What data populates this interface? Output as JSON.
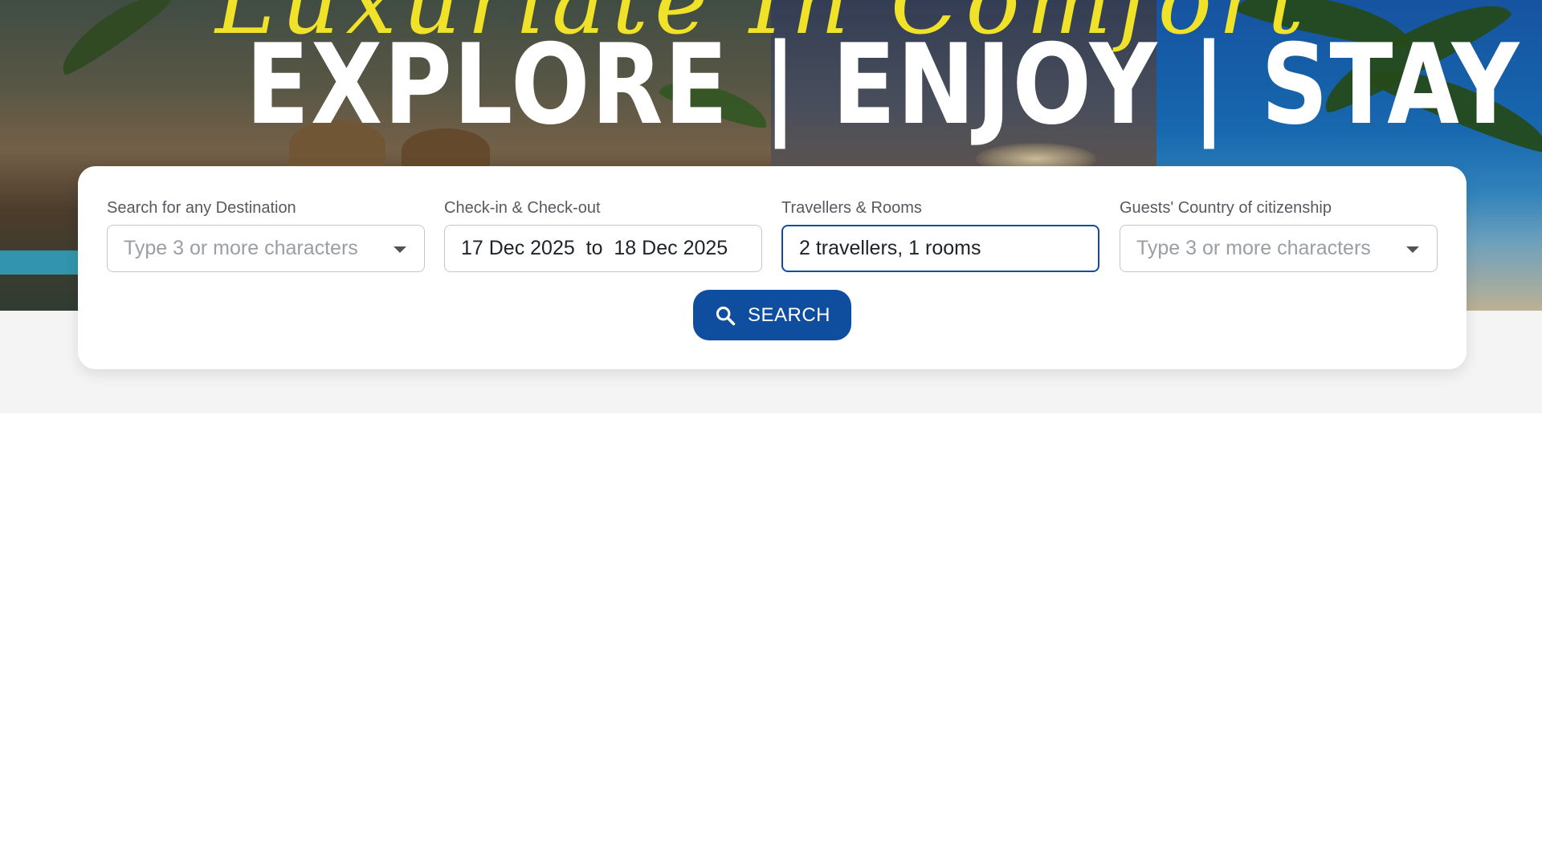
{
  "hero": {
    "script_title": "Luxuriate In Comfort",
    "title": "EXPLORE | ENJOY | STAY"
  },
  "search": {
    "destination": {
      "label": "Search for any Destination",
      "placeholder": "Type 3 or more characters"
    },
    "dates": {
      "label": "Check-in & Check-out",
      "value": "17 Dec 2025  to  18 Dec 2025"
    },
    "travellers": {
      "label": "Travellers & Rooms",
      "value": "2 travellers, 1 rooms"
    },
    "citizenship": {
      "label": "Guests' Country of citizenship",
      "placeholder": "Type 3 or more characters"
    },
    "button_label": "SEARCH"
  },
  "icons": {
    "search_button": "search-icon",
    "dropdowns": "chevron-down-icon"
  },
  "colors": {
    "primary": "#0f4d9e",
    "script_title": "#f0e228",
    "band": "#f4f4f4"
  }
}
